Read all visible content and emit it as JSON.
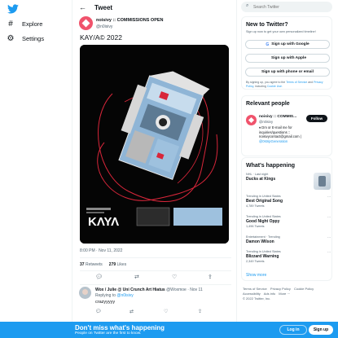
{
  "nav": {
    "logo": "twitter-bird-icon",
    "items": [
      {
        "icon": "hashtag-icon",
        "label": "Explore"
      },
      {
        "icon": "gear-icon",
        "label": "Settings"
      }
    ]
  },
  "header": {
    "title": "Tweet",
    "back_icon": "arrow-left-icon"
  },
  "tweet": {
    "author_name": "noisivy :: COMMISSIONS OPEN",
    "author_handle": "@n0isivy",
    "text": "KAY/A© 2022",
    "timestamp": "8:00 PM · Nov 11, 2022",
    "retweets_count": "37",
    "retweets_label": "Retweets",
    "likes_count": "279",
    "likes_label": "Likes",
    "actions": [
      "reply-icon",
      "retweet-icon",
      "like-icon",
      "share-icon"
    ]
  },
  "reply": {
    "name": "Wox / Julie @ Uni Crunch Art Hiatus",
    "handle_time": "@Woxmoe · Nov 11",
    "replying_prefix": "Replying to",
    "replying_to": "@n0isivy",
    "text": "crazyyyyy"
  },
  "search": {
    "placeholder": "Search Twitter"
  },
  "new_to_twitter": {
    "title": "New to Twitter?",
    "subtitle": "Sign up now to get your own personalized timeline!",
    "google": "Sign up with Google",
    "apple": "Sign up with Apple",
    "phone": "Sign up with phone or email",
    "legal_prefix": "By signing up, you agree to the",
    "terms": "Terms of Service",
    "and": "and",
    "privacy": "Privacy Policy",
    "including": ", including",
    "cookie": "Cookie Use."
  },
  "relevant": {
    "title": "Relevant people",
    "name": "noisivy :: COMMIS...",
    "handle": "@n0isivy",
    "follow": "Follow",
    "bio_line1": "♦ Dm or E-mail me for",
    "bio_line2": "inquiries/questions ::",
    "bio_line3": "noisivycontact@gmail.com |",
    "bio_link": "@0stripGeneration"
  },
  "trends": {
    "title": "What's happening",
    "items": [
      {
        "context": "NHL · Last night",
        "title": "Ducks at Kings",
        "count": ""
      },
      {
        "context": "Trending in United States",
        "title": "Best Original Song",
        "count": "4,789 Tweets"
      },
      {
        "context": "Trending in United States",
        "title": "Good Night Oppy",
        "count": "1,496 Tweets"
      },
      {
        "context": "Entertainment · Trending",
        "title": "Damon Wilson",
        "count": ""
      },
      {
        "context": "Trending in United States",
        "title": "Blizzard Warning",
        "count": "2,349 Tweets"
      }
    ],
    "show_more": "Show more"
  },
  "footer": {
    "links": [
      "Terms of Service",
      "Privacy Policy",
      "Cookie Policy",
      "Accessibility",
      "Ads info",
      "More ···"
    ],
    "copyright": "© 2022 Twitter, Inc."
  },
  "banner": {
    "title": "Don't miss what's happening",
    "subtitle": "People on Twitter are the first to know.",
    "login": "Log in",
    "signup": "Sign up"
  },
  "colors": {
    "accent": "#1d9bf0",
    "avatar": "#f0536c"
  }
}
